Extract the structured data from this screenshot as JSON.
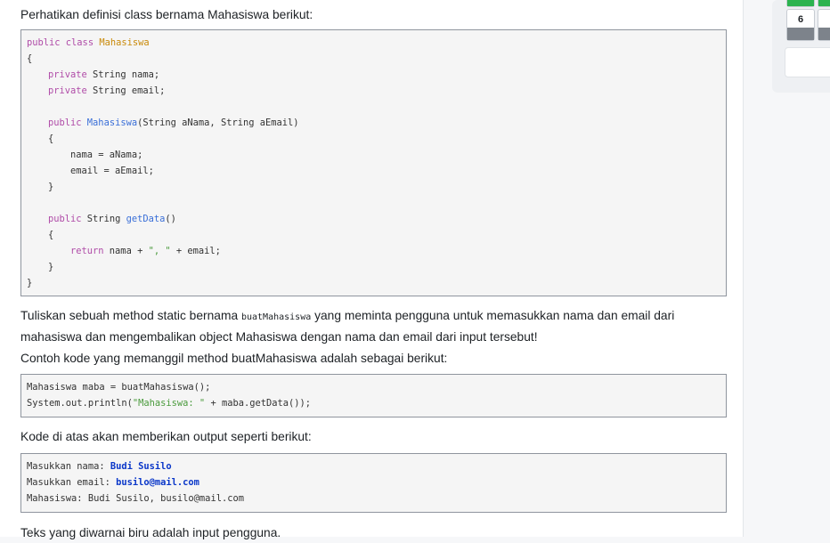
{
  "question": {
    "intro": "Perhatikan definisi class bernama Mahasiswa berikut:",
    "class_code": {
      "l1_kw": "public class ",
      "l1_name": "Mahasiswa",
      "l2": "{",
      "l3_kw": "private ",
      "l3_rest": "String nama;",
      "l4_kw": "private ",
      "l4_rest": "String email;",
      "l6_kw": "public ",
      "l6_name": "Mahasiswa",
      "l6_rest": "(String aNama, String aEmail)",
      "l7": "{",
      "l8": "nama = aNama;",
      "l9": "email = aEmail;",
      "l10": "}",
      "l12_kw": "public ",
      "l12_type": "String ",
      "l12_name": "getData",
      "l12_rest": "()",
      "l13": "{",
      "l14_kw": "return ",
      "l14_a": "nama + ",
      "l14_str": "\", \"",
      "l14_b": " + email;",
      "l15": "}",
      "l16": "}"
    },
    "task_part1": "Tuliskan sebuah method static bernama ",
    "task_code": "buatMahasiswa",
    "task_part2": " yang meminta pengguna untuk memasukkan nama dan email dari mahasiswa dan mengembalikan object Mahasiswa dengan nama dan email dari input tersebut!",
    "example_intro": "Contoh kode yang memanggil method buatMahasiswa adalah sebagai berikut:",
    "example_code": {
      "l1": "Mahasiswa maba = buatMahasiswa();",
      "l2_a": "System.out.println(",
      "l2_str": "\"Mahasiswa: \"",
      "l2_b": " + maba.getData());"
    },
    "output_intro": "Kode di atas akan memberikan output seperti berikut:",
    "output_code": {
      "l1_prompt": "Masukkan nama: ",
      "l1_input": "Budi Susilo",
      "l2_prompt": "Masukkan email: ",
      "l2_input": "busilo@mail.com",
      "l3": "Mahasiswa: Budi Susilo, busilo@mail.com"
    },
    "note": "Teks yang diwarnai biru adalah input pengguna."
  },
  "navigation": {
    "question_number": "6"
  },
  "colors": {
    "keyword": "#b04ca8",
    "type_name": "#c98a0a",
    "function": "#3a6fd8",
    "string": "#4a9a3c",
    "user_input": "#0a37c9",
    "nav_answered": "#2bb34f"
  }
}
